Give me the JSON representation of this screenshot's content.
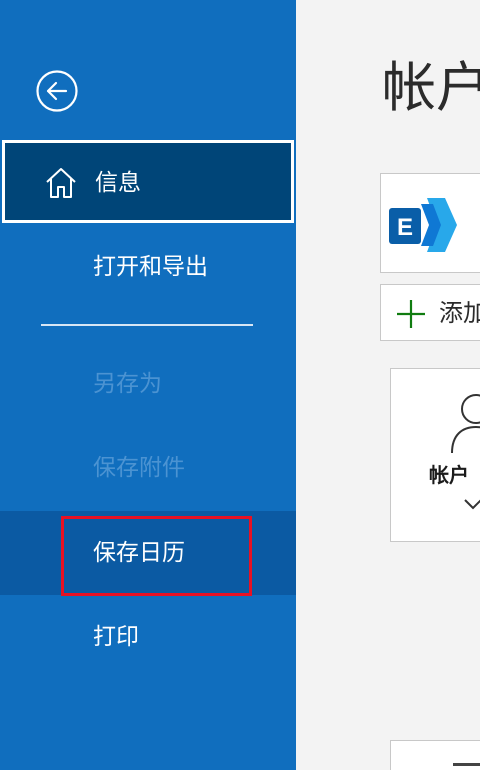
{
  "sidebar": {
    "background": "#106ebe",
    "back_icon": "arrow-left-circle-icon",
    "items": [
      {
        "label": "信息",
        "icon": "home-icon",
        "selected": true
      },
      {
        "label": "打开和导出"
      },
      {
        "label": "另存为",
        "disabled": true
      },
      {
        "label": "保存附件",
        "disabled": true
      },
      {
        "label": "保存日历",
        "highlighted": true
      },
      {
        "label": "打印"
      }
    ]
  },
  "main": {
    "title": "帐户",
    "account_icon": "exchange-icon",
    "add_account_label": "添加",
    "settings_tile_label": "帐户",
    "settings_tile_icon": "person-settings-icon"
  },
  "colors": {
    "selected_bg": "#004578",
    "highlight_border": "#e81123",
    "disabled_text": "#4b93d2",
    "plus_green": "#107c10",
    "exchange_blue": "#0078d4"
  }
}
